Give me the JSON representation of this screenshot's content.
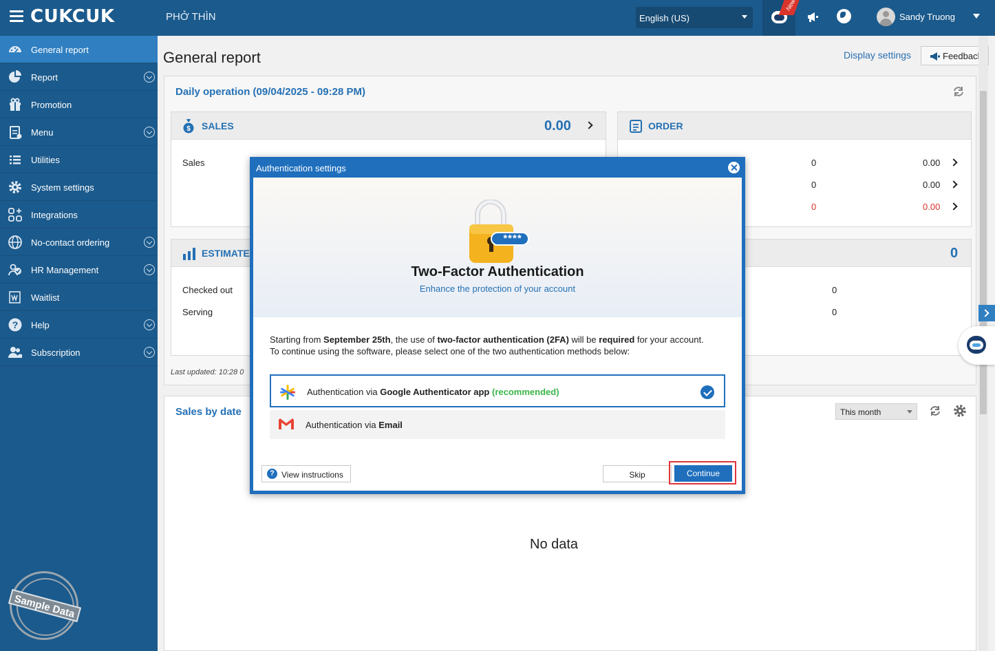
{
  "topbar": {
    "logo": "CUKCUK",
    "store": "PHỞ THÌN",
    "language": "English (US)",
    "new_badge": "New",
    "username": "Sandy Truong"
  },
  "sidebar": {
    "items": [
      {
        "label": "General report",
        "icon": "dashboard-icon",
        "active": true,
        "expandable": false
      },
      {
        "label": "Report",
        "icon": "pie-chart-icon",
        "expandable": true
      },
      {
        "label": "Promotion",
        "icon": "gift-icon",
        "expandable": false
      },
      {
        "label": "Menu",
        "icon": "menu-clipboard-icon",
        "expandable": true
      },
      {
        "label": "Utilities",
        "icon": "list-icon",
        "expandable": false
      },
      {
        "label": "System settings",
        "icon": "gear-icon",
        "expandable": false
      },
      {
        "label": "Integrations",
        "icon": "integrations-icon",
        "expandable": false
      },
      {
        "label": "No-contact ordering",
        "icon": "globe-icon",
        "expandable": true
      },
      {
        "label": "HR Management",
        "icon": "people-icon",
        "expandable": true
      },
      {
        "label": "Waitlist",
        "icon": "waitlist-icon",
        "expandable": false
      },
      {
        "label": "Help",
        "icon": "help-icon",
        "expandable": true
      },
      {
        "label": "Subscription",
        "icon": "subscription-icon",
        "expandable": true
      }
    ],
    "stamp": "Sample Data"
  },
  "main": {
    "title": "General report",
    "display_settings": "Display settings",
    "feedback": "Feedback",
    "daily": {
      "title": "Daily operation (09/04/2025 - 09:28 PM)",
      "sales_title": "SALES",
      "sales_value": "0.00",
      "sales_row": "Sales",
      "order_title": "ORDER",
      "order_rows": [
        {
          "count": "0",
          "value": "0.00",
          "red": false
        },
        {
          "count": "0",
          "value": "0.00",
          "red": false
        },
        {
          "count": "0",
          "value": "0.00",
          "red": true
        }
      ],
      "estimate_title": "ESTIMATE",
      "estimate_total": "0",
      "checked_out": "Checked out",
      "serving": "Serving",
      "checked_out_value": "0",
      "serving_value": "0",
      "last_updated": "Last updated:   10:28 0"
    },
    "sales_by_date": {
      "title": "Sales by date",
      "period": "This month",
      "empty": "No data"
    }
  },
  "modal": {
    "header": "Authentication settings",
    "title": "Two-Factor Authentication",
    "subtitle": "Enhance the protection of your account",
    "lock_text": "****",
    "intro_1": "Starting from ",
    "intro_date": "September 25th",
    "intro_2": ", the use of ",
    "intro_2fa": "two-factor authentication (2FA)",
    "intro_3": " will be ",
    "intro_required": "required",
    "intro_4": " for your account. To continue using the software, please select one of the two authentication methods below:",
    "option_google_prefix": "Authentication via ",
    "option_google_name": "Google Authenticator app",
    "option_google_tag": "(recommended)",
    "option_email_prefix": "Authentication via ",
    "option_email_name": "Email",
    "view_instructions": "View instructions",
    "skip": "Skip",
    "continue": "Continue"
  },
  "colors": {
    "brand": "#1b5a8c",
    "active": "#2f7fc1",
    "accent": "#2470b4",
    "highlight": "#e0343a",
    "recommended": "#3bb54a"
  }
}
